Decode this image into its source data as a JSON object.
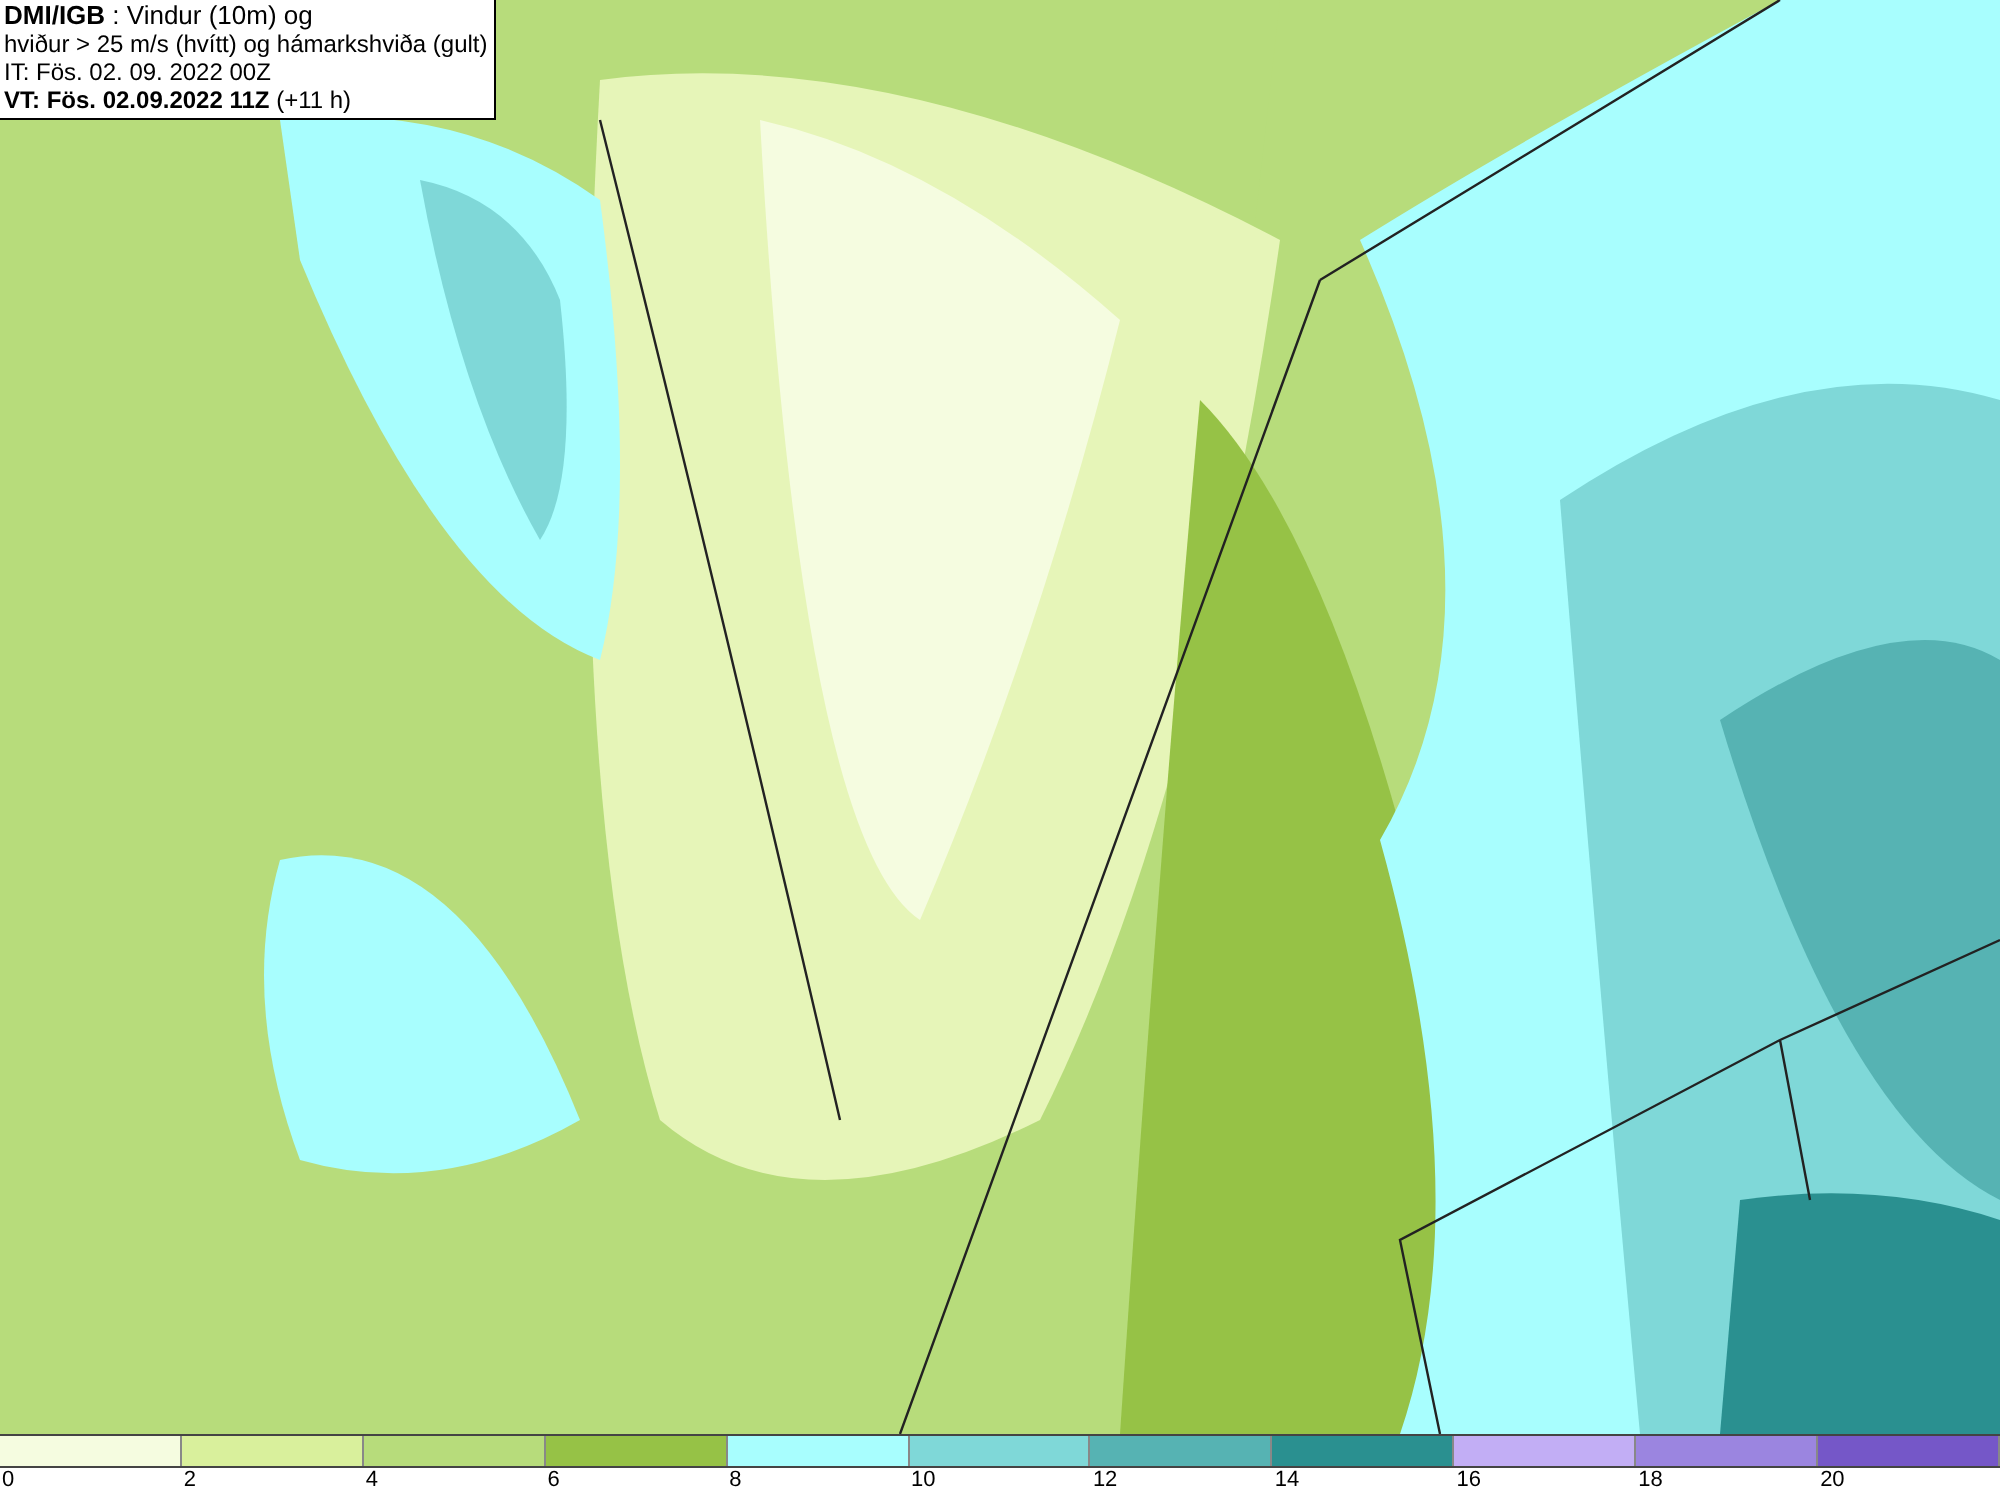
{
  "info_box": {
    "lines": [
      "**DMI/IGB** : Vindur (10m) og",
      "hviður > 25 m/s (hvítt) og hámarkshviða (gult)",
      "IT: Fös. 02. 09. 2022 00Z",
      "**VT: Fös. 02.09.2022 11Z** (+11 h)"
    ]
  },
  "legend": {
    "segments": [
      {
        "label": "0",
        "color": "#f5fce0"
      },
      {
        "label": "2",
        "color": "#d9f09c"
      },
      {
        "label": "4",
        "color": "#b7dc7b"
      },
      {
        "label": "6",
        "color": "#96c246"
      },
      {
        "label": "8",
        "color": "#a8fefe"
      },
      {
        "label": "10",
        "color": "#7fd8d8"
      },
      {
        "label": "12",
        "color": "#56b3b3"
      },
      {
        "label": "14",
        "color": "#2a9090"
      },
      {
        "label": "16",
        "color": "#c2aef5"
      },
      {
        "label": "18",
        "color": "#9b85e0"
      },
      {
        "label": "20",
        "color": "#7557c8"
      }
    ]
  }
}
